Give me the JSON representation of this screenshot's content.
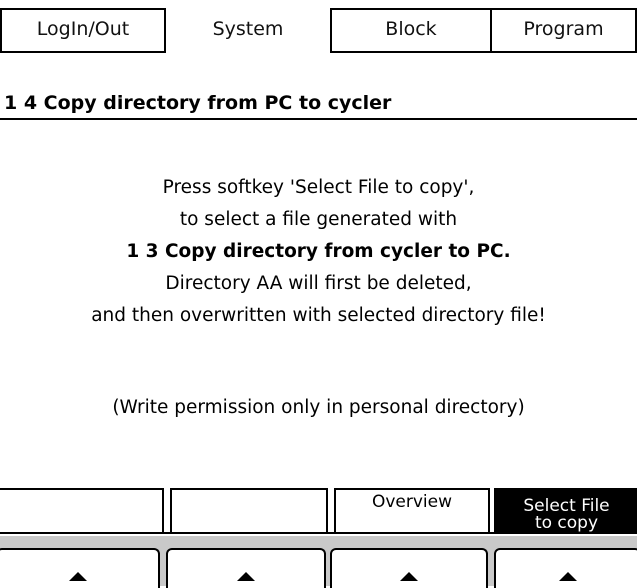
{
  "tabs": [
    {
      "label": "LogIn/Out",
      "active": false
    },
    {
      "label": "System",
      "active": true
    },
    {
      "label": "Block",
      "active": false
    },
    {
      "label": "Program",
      "active": false
    }
  ],
  "heading": "1 4 Copy directory from PC to cycler",
  "message": {
    "line1": "Press softkey 'Select File to copy',",
    "line2": "to select a file generated with",
    "line3": "1 3 Copy directory from cycler to PC.",
    "line4": "Directory AA will first be deleted,",
    "line5": "and then overwritten with selected directory file!",
    "note": "(Write permission only in personal directory)"
  },
  "softkeys": [
    {
      "label": ""
    },
    {
      "label": ""
    },
    {
      "label": "Overview"
    },
    {
      "label_line1": "Select File",
      "label_line2": "to copy",
      "highlighted": true
    }
  ],
  "arrow_buttons": [
    "up-arrow-icon",
    "up-arrow-icon",
    "up-arrow-icon",
    "up-arrow-icon"
  ],
  "colors": {
    "highlight_bg": "#000000",
    "strip_gray": "#c9c9c9"
  }
}
